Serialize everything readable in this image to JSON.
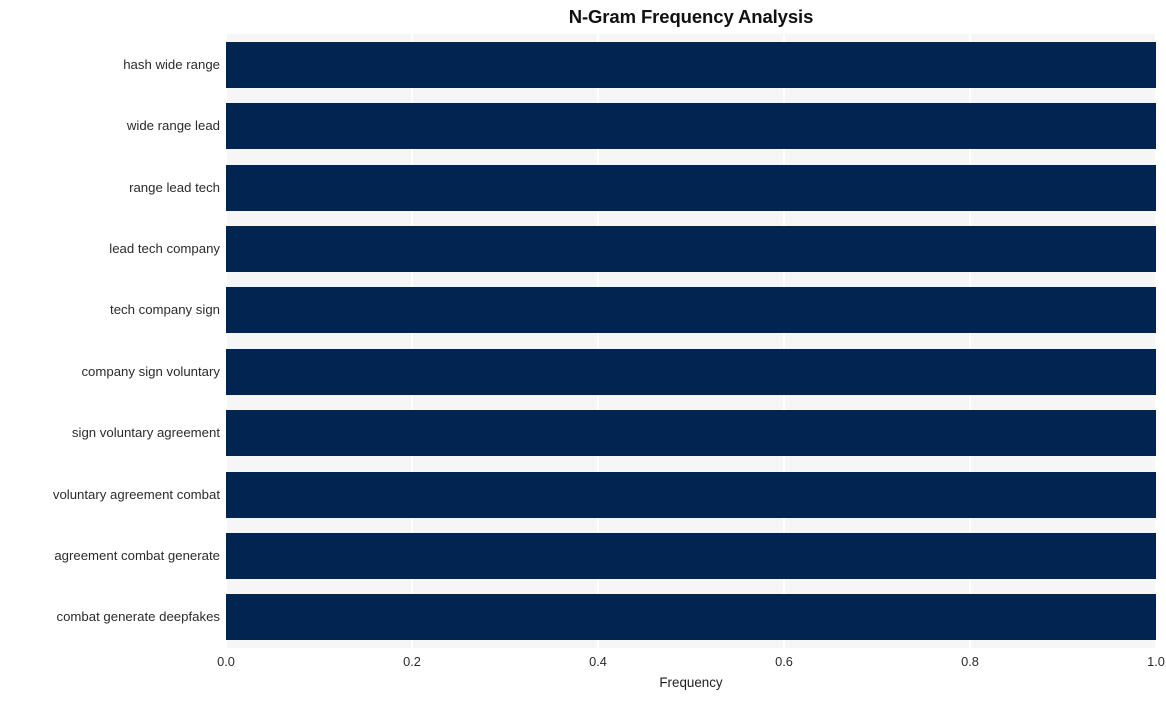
{
  "chart_data": {
    "type": "bar",
    "orientation": "horizontal",
    "title": "N-Gram Frequency Analysis",
    "xlabel": "Frequency",
    "ylabel": "",
    "categories": [
      "hash wide range",
      "wide range lead",
      "range lead tech",
      "lead tech company",
      "tech company sign",
      "company sign voluntary",
      "sign voluntary agreement",
      "voluntary agreement combat",
      "agreement combat generate",
      "combat generate deepfakes"
    ],
    "values": [
      1.0,
      1.0,
      1.0,
      1.0,
      1.0,
      1.0,
      1.0,
      1.0,
      1.0,
      1.0
    ],
    "xlim": [
      0.0,
      1.0
    ],
    "xticks": [
      0.0,
      0.2,
      0.4,
      0.6,
      0.8,
      1.0
    ],
    "xtick_labels": [
      "0.0",
      "0.2",
      "0.4",
      "0.6",
      "0.8",
      "1.0"
    ],
    "grid": true,
    "grid_axis": "both",
    "legend": false,
    "legend_position": "none",
    "colors": {
      "bar": "#012550",
      "plot_background": "#f6f6f7",
      "figure_background": "#ffffff",
      "gridline": "#ffffff",
      "title_text": "#111111",
      "tick_text": "#2b2b2b"
    }
  }
}
